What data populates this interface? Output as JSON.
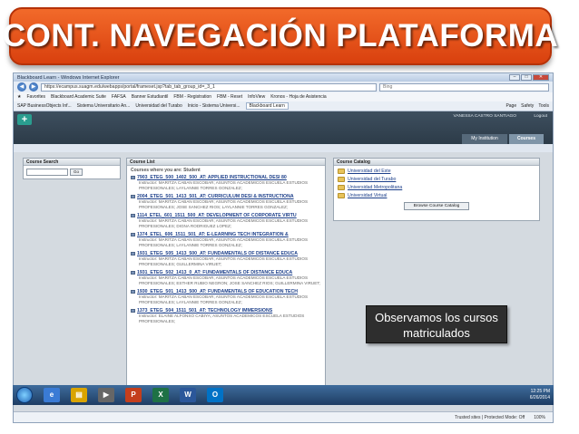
{
  "slide": {
    "title": "CONT. NAVEGACIÓN PLATAFORMA",
    "callout_line1": "Observamos los cursos",
    "callout_line2": "matriculados"
  },
  "browser": {
    "window_title": "Blackboard Learn - Windows Internet Explorer",
    "url": "https://ecampus.suagm.edu/webapps/portal/frameset.jsp?tab_tab_group_id=_3_1",
    "search_placeholder": "Bing",
    "favorites_label": "Favorites",
    "favorites": [
      "Blackboard Academic Suite",
      "FAFSA",
      "Banner Estudiantil",
      "FBM - Registration",
      "FBM - Reset",
      "InfoView",
      "Kronos - Hoja de Asistencia"
    ],
    "tabs": [
      "SAP BusinessObjects Inf...",
      "Sistema Universitario An...",
      "Universidad del Turabo",
      "Inicio - Sistema Universi...",
      "Blackboard Learn"
    ],
    "active_tab": "Blackboard Learn",
    "tools": [
      "Page",
      "Safety",
      "Tools"
    ],
    "status_zone": "Trusted sites | Protected Mode: Off",
    "zoom": "100%"
  },
  "blackboard": {
    "user_name": "VANESSA CASTRO SANTIAGO",
    "logout_label": "Logout",
    "tab_institution": "My Institution",
    "tab_courses": "Courses",
    "course_search": {
      "title": "Course Search",
      "go_label": "Go"
    },
    "course_list": {
      "title": "Course List",
      "heading": "Courses where you are: Student",
      "courses": [
        {
          "name": "7903_ETEG_500_1402_500_AT: APPLIED INSTRUCTIONAL DESI 80",
          "instructor": "Instructor: MARITZA CABAN ESCOBAR; ASUNTOS ACADEMICOS ESCUELA ESTUDIOS PROFESIONALES; LAYLANNIE TORRES GONZALEZ;"
        },
        {
          "name": "2004_ETEG_501_1413_501_AT: CURRICULUM DESI & INSTRUCTIONA",
          "instructor": "Instructor: MARITZA CABAN ESCOBAR; ASUNTOS ACADEMICOS ESCUELA ESTUDIOS PROFESIONALES; JOSE SANCHEZ RIOS; LAYLANNIE TORRES GONZALEZ;"
        },
        {
          "name": "1114_ETEL_601_1511_500_AT: DEVELOPMENT OF CORPORATE VIRTU",
          "instructor": "Instructor: MARITZA CABAN ESCOBAR; ASUNTOS ACADEMICOS ESCUELA ESTUDIOS PROFESIONALES; DIGNA RODRIGUEZ LOPEZ;"
        },
        {
          "name": "1374_ETEL_606_1511_501_AT: E-LEARNING TECH INTEGRATION &",
          "instructor": "Instructor: MARITZA CABAN ESCOBAR; ASUNTOS ACADEMICOS ESCUELA ESTUDIOS PROFESIONALES; LAYLANNIE TORRES GONZALEZ;"
        },
        {
          "name": "1931_ETEG_505_1413_500_AT: FUNDAMENTALS OF DISTANCE EDUCA",
          "instructor": "Instructor: MARITZA CABAN ESCOBAR; ASUNTOS ACADEMICOS ESCUELA ESTUDIOS PROFESIONALES; GUILLERMINA VIRUET;"
        },
        {
          "name": "1931_ETEG_502_1413_0_AT: FUNDAMENTALS OF DISTANCE EDUCA",
          "instructor": "Instructor: MARITZA CABAN ESCOBAR; ASUNTOS ACADEMICOS ESCUELA ESTUDIOS PROFESIONALES; ESTHER RUBIO NEGRON; JOSE SANCHEZ RIOS; GUILLERMINA VIRUET;"
        },
        {
          "name": "1930_ETEG_501_1413_500_AT: FUNDAMENTALS OF EDUCATION TECH",
          "instructor": "Instructor: MARITZA CABAN ESCOBAR; ASUNTOS ACADEMICOS ESCUELA ESTUDIOS PROFESIONALES; LAYLANNIE TORRES GONZALEZ;"
        },
        {
          "name": "1373_ETEG_504_1511_501_AT: TECHNOLOGY IMMERSIONS",
          "instructor": "Instructor: ELAINE ALFONSO CABIYA; ASUNTOS ACADEMICOS ESCUELA ESTUDIOS PROFESIONALES;"
        }
      ]
    },
    "course_catalog": {
      "title": "Course Catalog",
      "items": [
        "Universidad del Este",
        "Universidad del Turabo",
        "Universidad Metropolitana",
        "Universidad Virtual"
      ],
      "browse_label": "Browse Course Catalog"
    }
  },
  "taskbar": {
    "time": "12:25 PM",
    "date": "6/26/2014"
  }
}
